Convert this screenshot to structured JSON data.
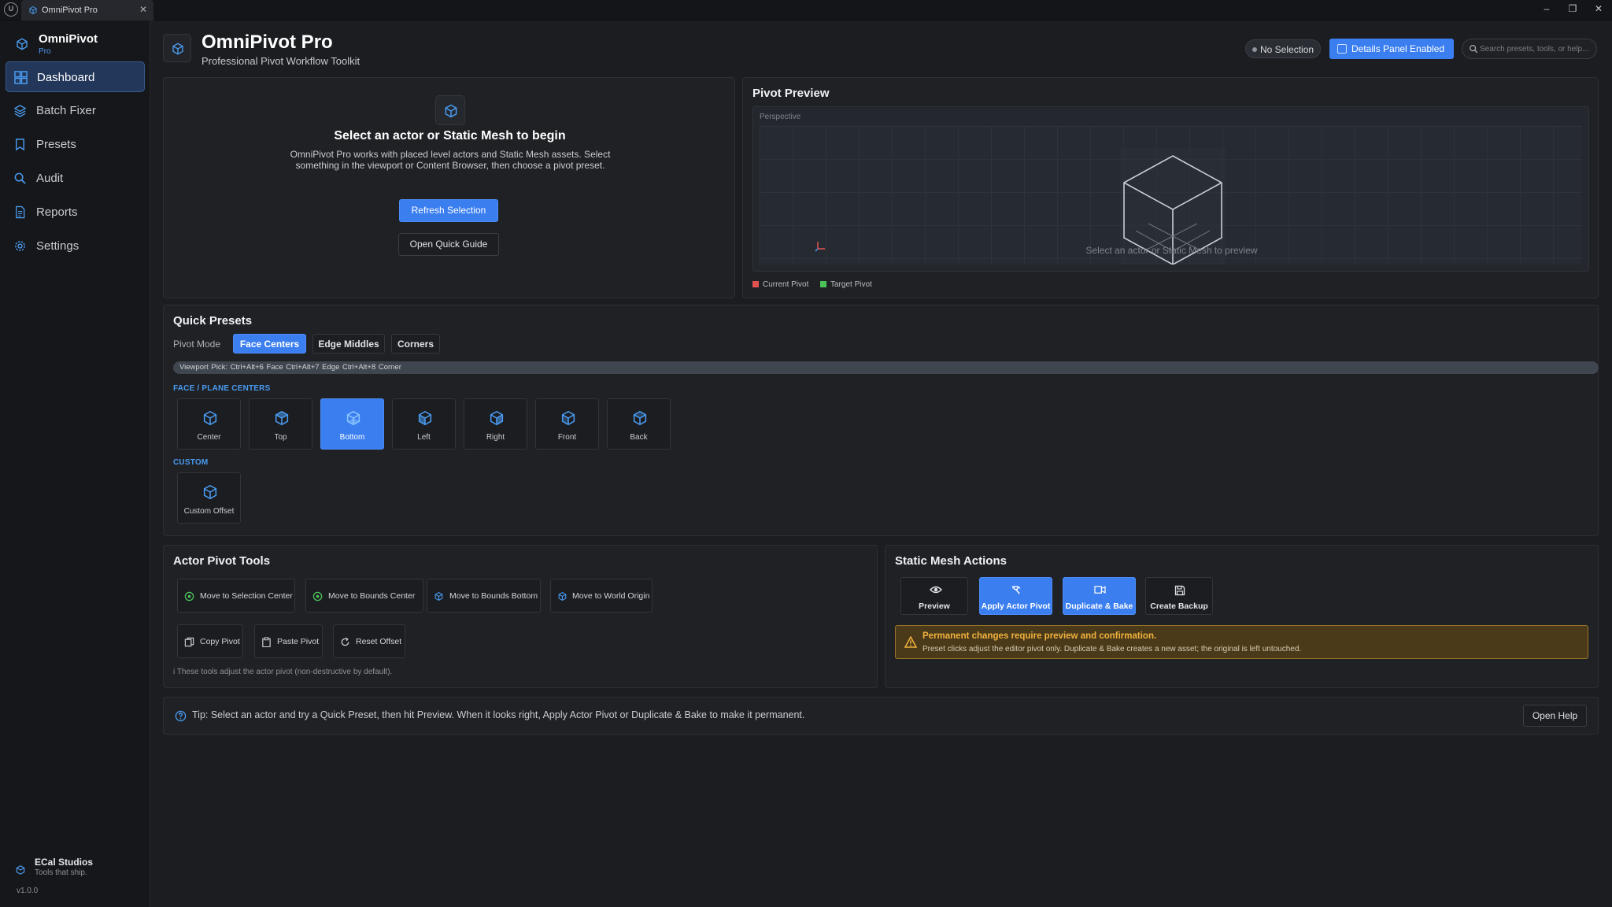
{
  "window": {
    "tab_label": "OmniPivot Pro",
    "logo_text": "U"
  },
  "sidebar": {
    "brand_name": "OmniPivot",
    "brand_sub": "Pro",
    "items": [
      {
        "label": "Dashboard",
        "icon": "grid-icon"
      },
      {
        "label": "Batch Fixer",
        "icon": "layers-icon"
      },
      {
        "label": "Presets",
        "icon": "bookmark-icon"
      },
      {
        "label": "Audit",
        "icon": "search-icon"
      },
      {
        "label": "Reports",
        "icon": "document-icon"
      },
      {
        "label": "Settings",
        "icon": "gear-icon"
      }
    ],
    "studio_name": "ECal Studios",
    "studio_tagline": "Tools that ship.",
    "version": "v1.0.0"
  },
  "header": {
    "title": "OmniPivot Pro",
    "subtitle": "Professional Pivot Workflow Toolkit",
    "selection_status": "No Selection",
    "details_button": "Details Panel Enabled",
    "search_placeholder": "Search presets, tools, or help..."
  },
  "welcome": {
    "title": "Select an actor or Static Mesh to begin",
    "description": "OmniPivot Pro works with placed level actors and Static Mesh assets. Select something in the viewport or Content Browser, then choose a pivot preset.",
    "refresh_button": "Refresh Selection",
    "guide_button": "Open Quick Guide"
  },
  "preview": {
    "title": "Pivot Preview",
    "viewport_label": "Perspective",
    "hint": "Select an actor or Static Mesh to preview",
    "legend": [
      {
        "label": "Current Pivot",
        "color": "#e05252"
      },
      {
        "label": "Target Pivot",
        "color": "#4cc35a"
      }
    ]
  },
  "quick_presets": {
    "title": "Quick Presets",
    "mode_label": "Pivot Mode",
    "modes": [
      "Face Centers",
      "Edge Middles",
      "Corners"
    ],
    "active_mode": "Face Centers",
    "shortcut_hint": "Viewport Pick: Ctrl+Alt+6 Face   Ctrl+Alt+7 Edge   Ctrl+Alt+8 Corner",
    "face_section": "FACE / PLANE CENTERS",
    "face_presets": [
      "Center",
      "Top",
      "Bottom",
      "Left",
      "Right",
      "Front",
      "Back"
    ],
    "selected_preset": "Bottom",
    "custom_section": "CUSTOM",
    "custom_presets": [
      "Custom Offset"
    ]
  },
  "actor_tools": {
    "title": "Actor Pivot Tools",
    "row1": [
      "Move to Selection Center",
      "Move to Bounds Center",
      "Move to Bounds Bottom",
      "Move to World Origin"
    ],
    "row2": [
      "Copy Pivot",
      "Paste Pivot",
      "Reset Offset"
    ],
    "note": "i These tools adjust the actor pivot (non-destructive by default)."
  },
  "static_mesh": {
    "title": "Static Mesh Actions",
    "buttons": [
      "Preview",
      "Apply Actor Pivot",
      "Duplicate & Bake",
      "Create Backup"
    ],
    "warning_title": "Permanent changes require preview and confirmation.",
    "warning_body": "Preset clicks adjust the editor pivot only. Duplicate & Bake creates a new asset; the original is left untouched."
  },
  "tip": {
    "text": "Tip: Select an actor and try a Quick Preset, then hit Preview. When it looks right, Apply Actor Pivot or Duplicate & Bake to make it permanent.",
    "help_button": "Open Help"
  },
  "colors": {
    "accent": "#3a7ef0",
    "background": "#1b1d21",
    "panel": "#1f2125",
    "warning": "#f2b33d"
  }
}
